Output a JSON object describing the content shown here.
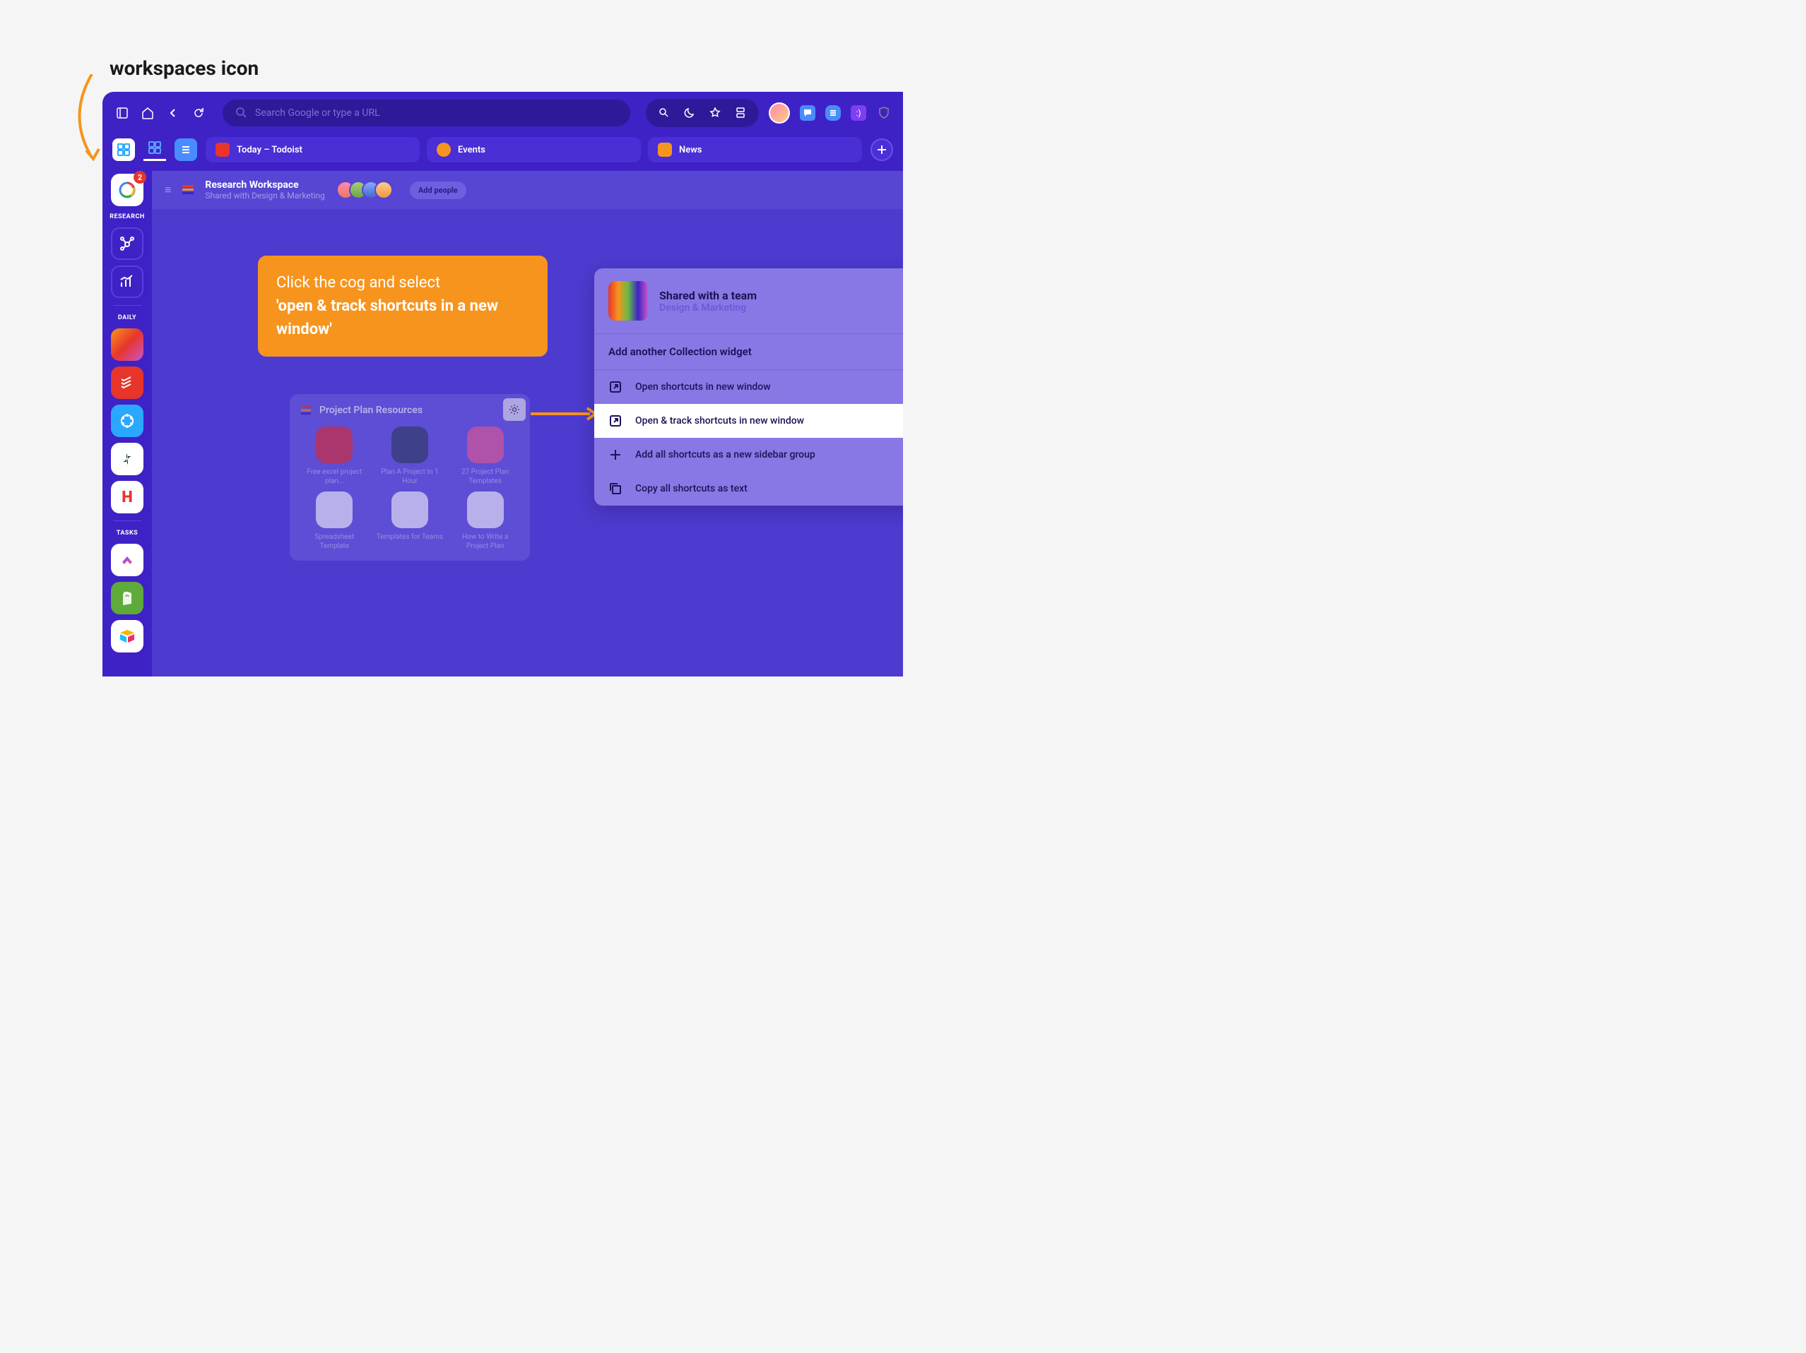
{
  "annotation": {
    "label": "workspaces icon"
  },
  "toolbar": {
    "search_placeholder": "Search Google or type a URL"
  },
  "tabs": [
    {
      "label": "Today – Todoist",
      "icon_bg": "#e7352b"
    },
    {
      "label": "Events",
      "icon_bg": "#f7941d"
    },
    {
      "label": "News",
      "icon_bg": "#f7941d"
    }
  ],
  "sidebar": {
    "google_badge": "2",
    "sections": [
      {
        "label": "RESEARCH"
      },
      {
        "label": "DAILY"
      },
      {
        "label": "TASKS"
      }
    ]
  },
  "workspace": {
    "title": "Research Workspace",
    "subtitle": "Shared with Design & Marketing",
    "add_people_label": "Add people"
  },
  "callout": {
    "line1": "Click the cog and select",
    "line2": "'open & track shortcuts in a new window'"
  },
  "widget": {
    "title": "Project Plan Resources",
    "shortcuts": [
      {
        "label": "Free excel project plan...",
        "bg": "#e7352b"
      },
      {
        "label": "Plan A Project In 1 Hour",
        "bg": "#334"
      },
      {
        "label": "27 Project Plan Templates",
        "bg": "#f15"
      },
      {
        "label": "Spreadsheet Template",
        "bg": "#fff"
      },
      {
        "label": "Templates for Teams",
        "bg": "#fff"
      },
      {
        "label": "How to Write a Project Plan",
        "bg": "#fff"
      }
    ]
  },
  "menu": {
    "top_title": "Shared with a team",
    "top_sub": "Design & Marketing",
    "subhead": "Add another Collection widget",
    "items": [
      {
        "icon": "open-external-icon",
        "label": "Open shortcuts in new window"
      },
      {
        "icon": "open-external-icon",
        "label": "Open & track shortcuts in new window",
        "highlight": true
      },
      {
        "icon": "plus-icon",
        "label": "Add all shortcuts as a new sidebar group"
      },
      {
        "icon": "copy-icon",
        "label": "Copy all shortcuts as text"
      }
    ]
  }
}
